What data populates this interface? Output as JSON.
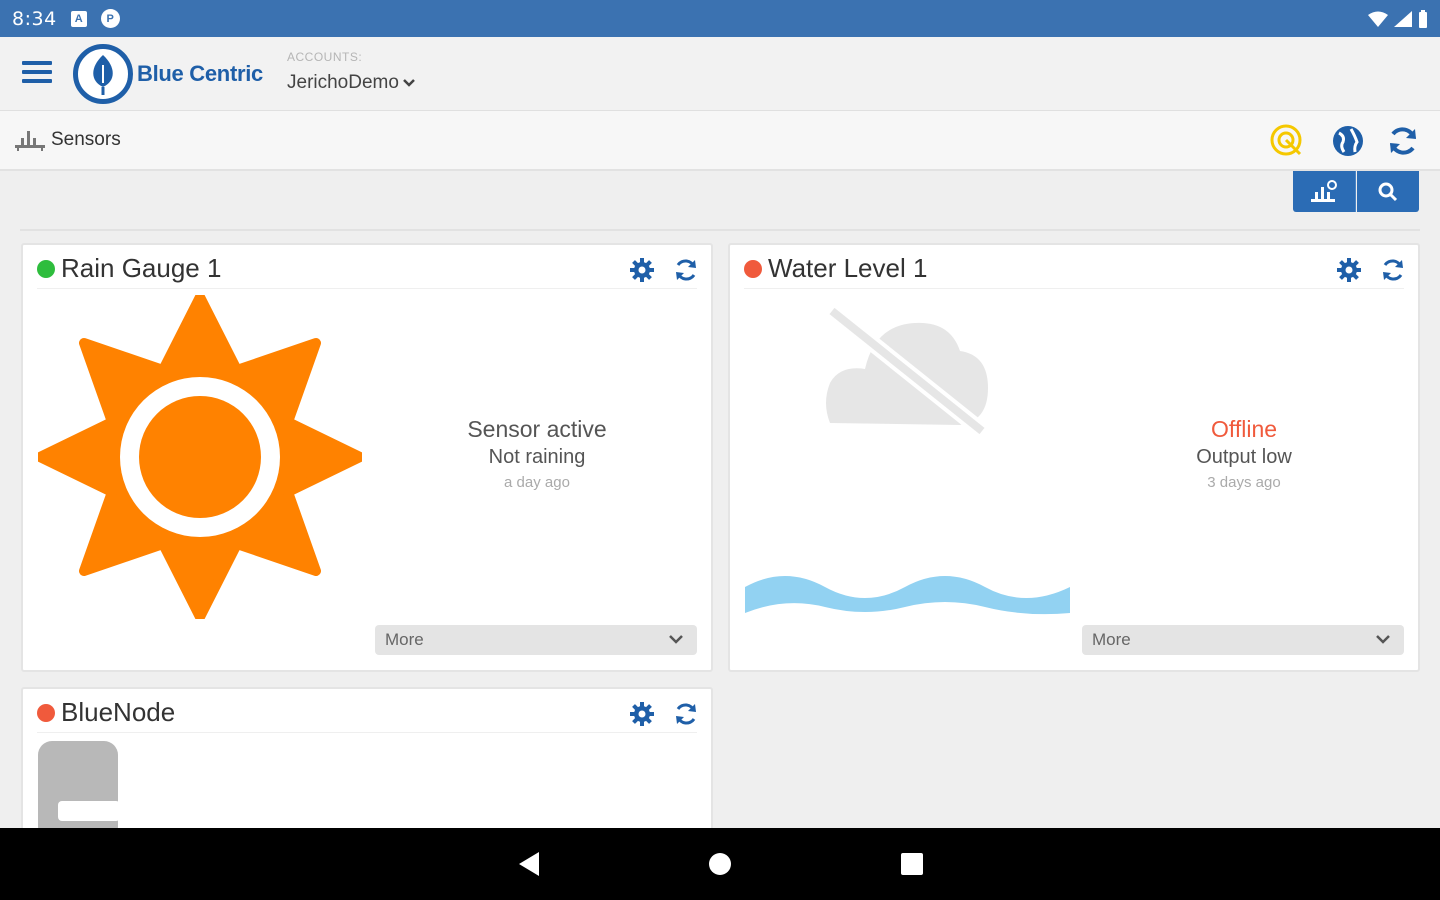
{
  "status_bar": {
    "time": "8:34",
    "notif_a": "A",
    "notif_p": "P"
  },
  "header": {
    "logo_text": "Blue Centric",
    "accounts_label": "ACCOUNTS:",
    "account_name": "JerichoDemo"
  },
  "subheader": {
    "breadcrumb": "Sensors"
  },
  "colors": {
    "brand_blue": "#1f5fa8",
    "status_green": "#2ebd3d",
    "status_red": "#f05a3c",
    "sun_orange": "#ff8200",
    "water_blue": "#92d2f2"
  },
  "sensors": [
    {
      "name": "Rain Gauge 1",
      "status_color": "green",
      "icon": "sun-icon",
      "line1": "Sensor active",
      "line2": "Not raining",
      "line3": "a day ago",
      "more_label": "More"
    },
    {
      "name": "Water Level 1",
      "status_color": "red",
      "icon": "cloud-off-icon",
      "line1": "Offline",
      "line2": "Output low",
      "line3": "3 days ago",
      "more_label": "More"
    },
    {
      "name": "BlueNode",
      "status_color": "red",
      "icon": "node-device-icon"
    }
  ]
}
